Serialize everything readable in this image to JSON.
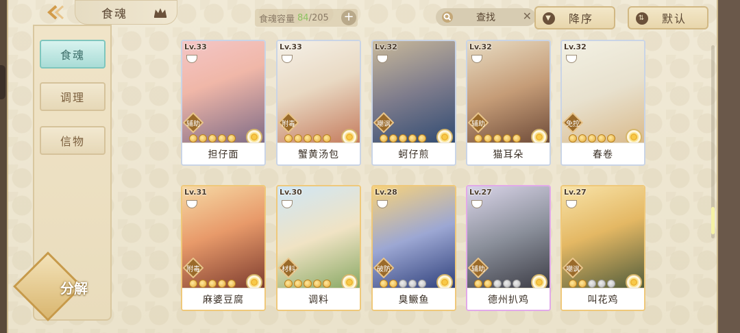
{
  "header": {
    "back_icon": "back-arrow-icon",
    "title": "食魂",
    "title_icon": "crown-icon",
    "capacity_label": "食魂容量",
    "capacity_current": "84",
    "capacity_max": "/205",
    "capacity_plus": "+",
    "search_label": "查找",
    "search_clear": "✕",
    "sort_order_label": "降序",
    "sort_mode_label": "默认"
  },
  "sidebar": {
    "items": [
      {
        "label": "食魂",
        "active": true
      },
      {
        "label": "调理",
        "active": false
      },
      {
        "label": "信物",
        "active": false
      }
    ],
    "decompose_label": "分解"
  },
  "cards": [
    {
      "level": "Lv.33",
      "role": "辅助",
      "name": "担仔面",
      "stars": 5,
      "frame": "blue"
    },
    {
      "level": "Lv.33",
      "role": "附毒",
      "name": "蟹黄汤包",
      "stars": 5,
      "frame": "blue"
    },
    {
      "level": "Lv.32",
      "role": "嘲讽",
      "name": "蚵仔煎",
      "stars": 5,
      "frame": "blue"
    },
    {
      "level": "Lv.32",
      "role": "辅助",
      "name": "猫耳朵",
      "stars": 5,
      "frame": "blue"
    },
    {
      "level": "Lv.32",
      "role": "免控",
      "name": "春卷",
      "stars": 5,
      "frame": "blue"
    },
    {
      "level": "Lv.31",
      "role": "附毒",
      "name": "麻婆豆腐",
      "stars": 5,
      "frame": "gold"
    },
    {
      "level": "Lv.30",
      "role": "材料",
      "name": "调料",
      "stars": 5,
      "frame": "gold"
    },
    {
      "level": "Lv.28",
      "role": "破防",
      "name": "臭鳜鱼",
      "stars": 2,
      "frame": "gold"
    },
    {
      "level": "Lv.27",
      "role": "辅助",
      "name": "德州扒鸡",
      "stars": 2,
      "frame": "rainbow"
    },
    {
      "level": "Lv.27",
      "role": "嘲讽",
      "name": "叫花鸡",
      "stars": 2,
      "frame": "gold"
    }
  ],
  "colors": {
    "capacity_current": "#8cc260",
    "active_tab": "#a9dcd6",
    "role_badge": "#9a6a2a"
  }
}
